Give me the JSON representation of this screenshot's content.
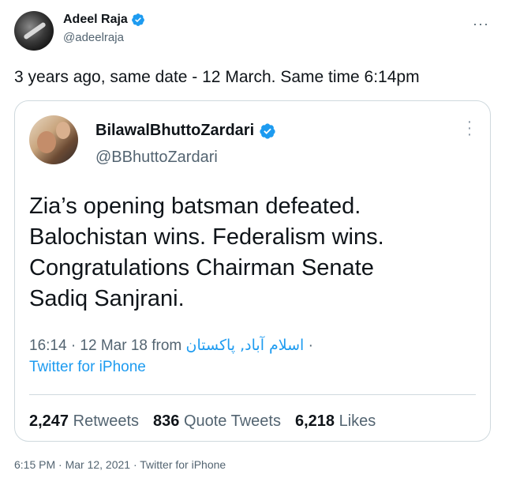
{
  "outer_tweet": {
    "author_name": "Adeel Raja",
    "author_handle": "@adeelraja",
    "text": "3 years ago, same date - 12 March. Same time 6:14pm",
    "more_icon": "ellipsis-icon",
    "footer": "6:15 PM · Mar 12, 2021 · Twitter for iPhone"
  },
  "quoted_tweet": {
    "author_name": "BilawalBhuttoZardari",
    "author_handle": "@BBhuttoZardari",
    "body_lines": [
      "Zia’s opening batsman defeated.",
      "Balochistan wins. Federalism wins.",
      "Congratulations Chairman Senate",
      "Sadiq Sanjrani."
    ],
    "time_date": "16:14 · 12 Mar 18 from ",
    "location": "اسلام آباد, پاکستان",
    "location_suffix": " ·",
    "source": "Twitter for iPhone",
    "stats": {
      "retweets_count": "2,247",
      "retweets_label": "Retweets",
      "quote_count": "836",
      "quote_label": "Quote Tweets",
      "likes_count": "6,218",
      "likes_label": "Likes"
    }
  },
  "colors": {
    "accent": "#1d9bf0",
    "muted": "#536471",
    "border": "#cfd9de"
  }
}
